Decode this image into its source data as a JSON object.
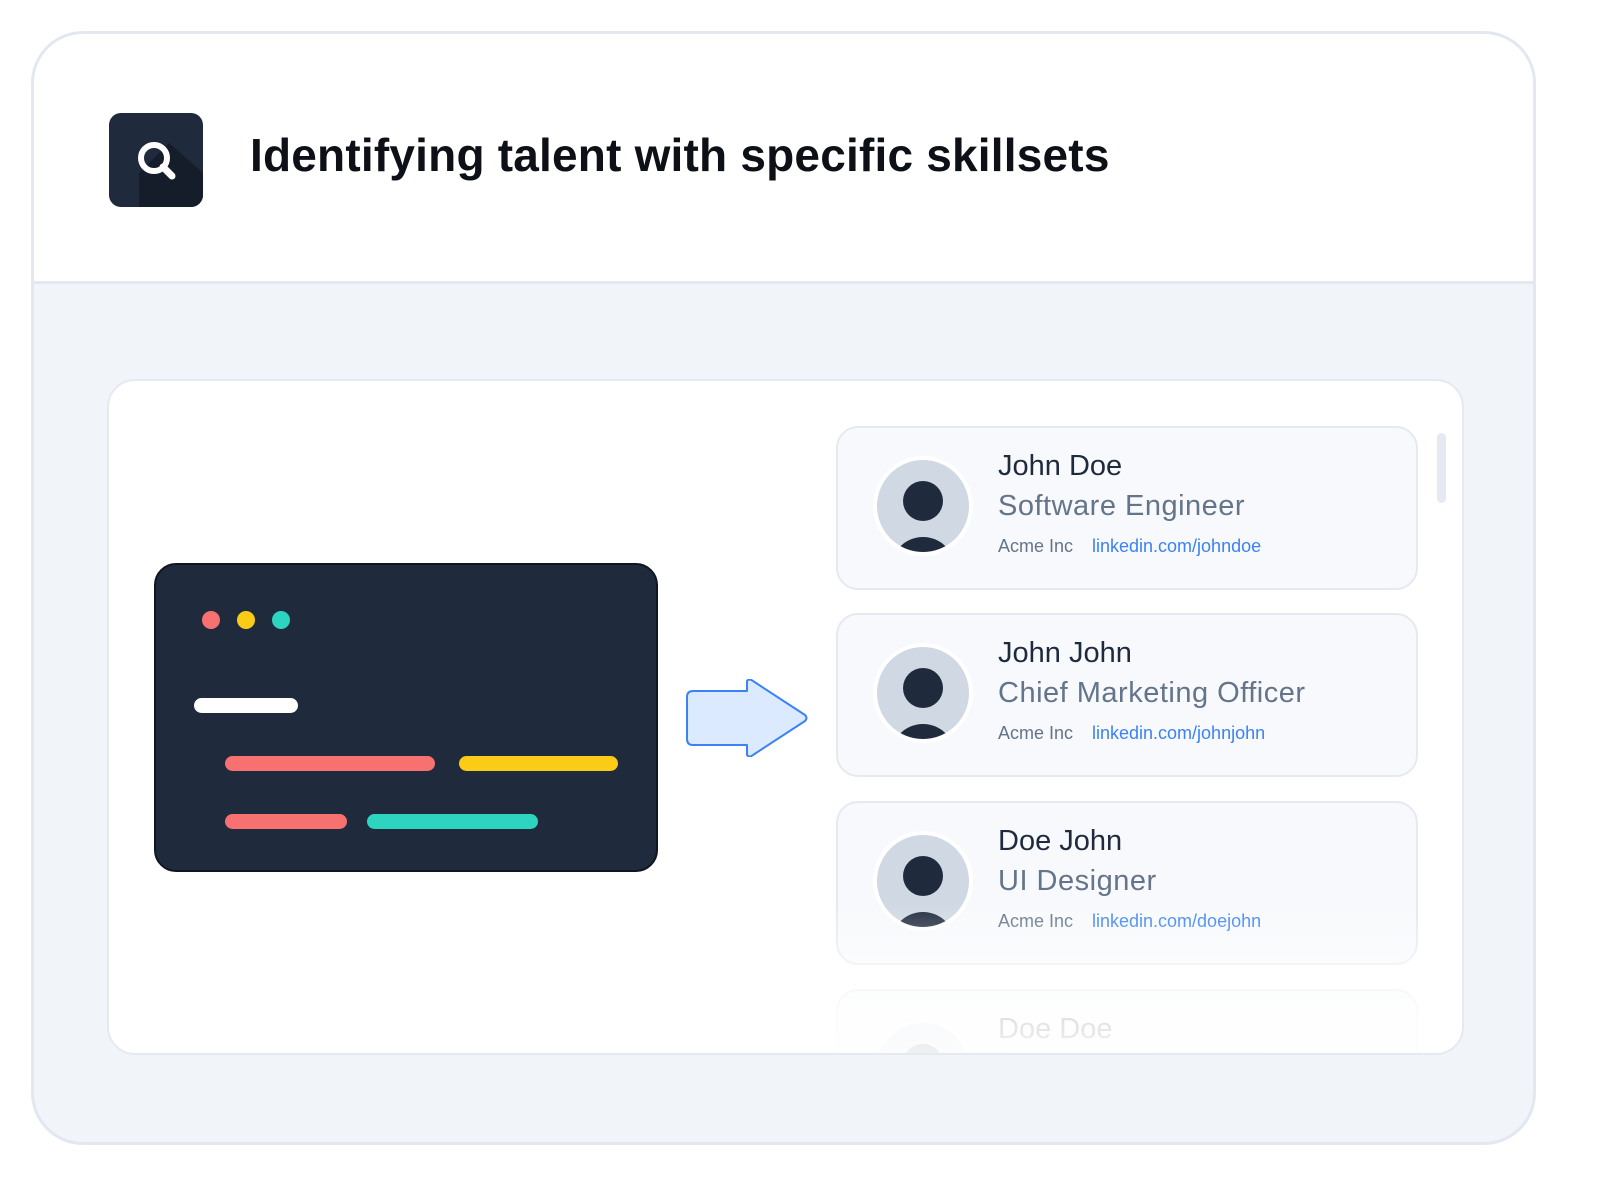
{
  "header": {
    "title": "Identifying talent with specific skillsets",
    "icon": "search-icon"
  },
  "code_window": {
    "dots": [
      "#f87171",
      "#facc15",
      "#2dd4bf"
    ]
  },
  "profiles": [
    {
      "name": "John Doe",
      "role": "Software Engineer",
      "company": "Acme Inc",
      "link": "linkedin.com/johndoe"
    },
    {
      "name": "John John",
      "role": "Chief Marketing Officer",
      "company": "Acme Inc",
      "link": "linkedin.com/johnjohn"
    },
    {
      "name": "Doe John",
      "role": "UI Designer",
      "company": "Acme Inc",
      "link": "linkedin.com/doejohn"
    },
    {
      "name": "Doe Doe",
      "role": "",
      "company": "",
      "link": ""
    }
  ],
  "colors": {
    "dark": "#1f2a3d",
    "accent": "#3b82f6",
    "arrow_fill": "#dbeafe"
  }
}
